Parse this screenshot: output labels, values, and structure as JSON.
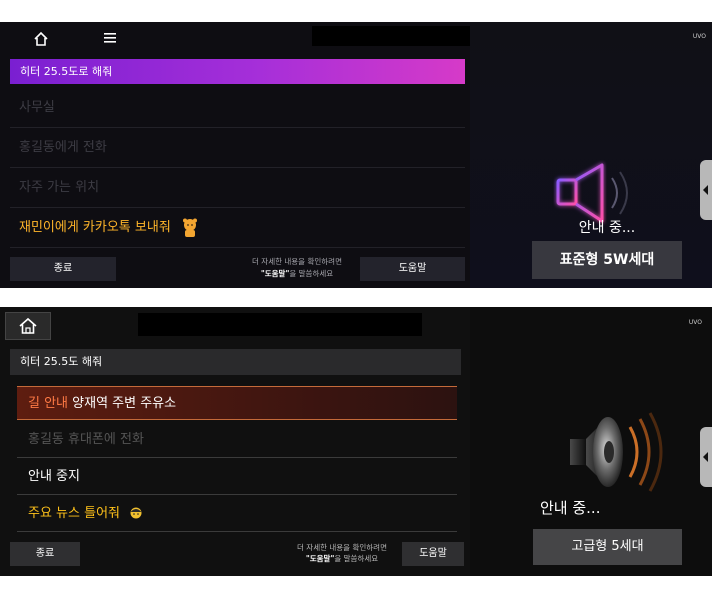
{
  "screen1": {
    "command": "히터 25.5도로 해줘",
    "items": [
      {
        "label": "사무실"
      },
      {
        "label": "홍길동에게 전화"
      },
      {
        "label": "자주 가는 위치"
      },
      {
        "label": "재민이에게 카카오톡 보내줘"
      }
    ],
    "end_label": "종료",
    "help_label": "도움말",
    "hint_line1": "더 자세한 내용을 확인하려면",
    "hint_bold": "\"도움말\"",
    "hint_line2": "을 말씀하세요",
    "logo": "UVO",
    "status": "안내 중...",
    "model": "표준형 5W세대"
  },
  "screen2": {
    "command": "히터 25.5도 해줘",
    "active_keyword": "길 안내",
    "active_rest": " 양재역 주변 주유소",
    "items": [
      {
        "label": "홍길동 휴대폰에 전화"
      },
      {
        "label": "안내 중지"
      },
      {
        "label": "주요 뉴스 틀어줘"
      }
    ],
    "end_label": "종료",
    "help_label": "도움말",
    "hint_line1": "더 자세한 내용을 확인하려면",
    "hint_bold": "\"도움말\"",
    "hint_line2": "을 말씀하세요",
    "logo": "UVO",
    "status": "안내 중...",
    "model": "고급형 5세대"
  },
  "colors": {
    "command_gradient_start": "#7a1fd1",
    "command_gradient_end": "#d63ac8",
    "highlight_yellow": "#ffb52a",
    "active_keyword": "#ff7a45"
  }
}
